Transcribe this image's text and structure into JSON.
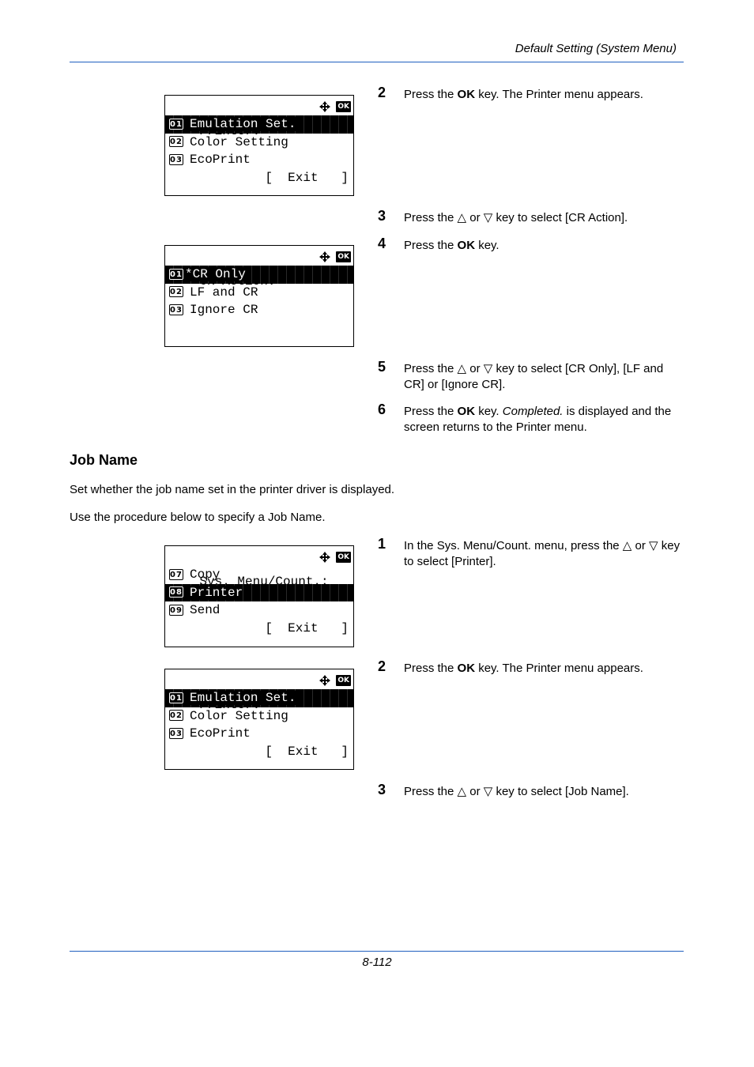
{
  "header": {
    "title": "Default Setting (System Menu)"
  },
  "footer": {
    "page_number": "8-112"
  },
  "screens": [
    {
      "title": "Printer:",
      "rows": [
        {
          "num": "01",
          "text": "Emulation Set.",
          "selected": true
        },
        {
          "num": "02",
          "text": "Color Setting",
          "selected": false
        },
        {
          "num": "03",
          "text": "EcoPrint",
          "selected": false
        }
      ],
      "exit": "[  Exit   ]"
    },
    {
      "title": "CR Action:",
      "rows": [
        {
          "num": "01",
          "text": "*CR Only",
          "selected": true
        },
        {
          "num": "02",
          "text": "LF and CR",
          "selected": false
        },
        {
          "num": "03",
          "text": "Ignore CR",
          "selected": false
        }
      ],
      "exit": ""
    },
    {
      "title": "Sys. Menu/Count.:",
      "rows": [
        {
          "num": "07",
          "text": "Copy",
          "selected": false
        },
        {
          "num": "08",
          "text": "Printer",
          "selected": true
        },
        {
          "num": "09",
          "text": "Send",
          "selected": false
        }
      ],
      "exit": "[  Exit   ]"
    },
    {
      "title": "Printer:",
      "rows": [
        {
          "num": "01",
          "text": "Emulation Set.",
          "selected": true
        },
        {
          "num": "02",
          "text": "Color Setting",
          "selected": false
        },
        {
          "num": "03",
          "text": "EcoPrint",
          "selected": false
        }
      ],
      "exit": "[  Exit   ]"
    }
  ],
  "icons": {
    "nav": "four-way-arrow-icon",
    "ok": "OK"
  },
  "steps_a": [
    {
      "n": "2",
      "parts": [
        "Press the ",
        "OK",
        " key. The Printer menu appears."
      ]
    },
    {
      "n": "3",
      "parts": [
        "Press the △ or ▽ key to select [CR Action]."
      ]
    },
    {
      "n": "4",
      "parts": [
        "Press the ",
        "OK",
        " key."
      ]
    },
    {
      "n": "5",
      "parts": [
        "Press the △ or ▽ key to select [CR Only], [LF and CR] or [Ignore CR]."
      ]
    },
    {
      "n": "6",
      "parts": [
        "Press the ",
        "OK",
        " key. ",
        "Completed.",
        " is displayed and the screen returns to the Printer menu."
      ]
    }
  ],
  "section": {
    "title": "Job Name",
    "description": "Set whether the job name set in the printer driver is displayed.",
    "procedure_intro": "Use the procedure below to specify a Job Name."
  },
  "steps_b": [
    {
      "n": "1",
      "parts": [
        "In the Sys. Menu/Count. menu, press the △ or ▽ key to select [Printer]."
      ]
    },
    {
      "n": "2",
      "parts": [
        "Press the ",
        "OK",
        " key. The Printer menu appears."
      ]
    },
    {
      "n": "3",
      "parts": [
        "Press the △ or ▽ key to select [Job Name]."
      ]
    }
  ]
}
